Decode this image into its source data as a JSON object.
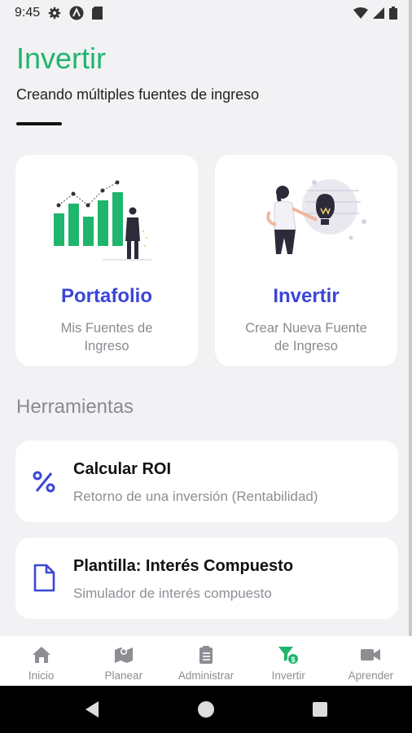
{
  "status": {
    "time": "9:45",
    "left_icons": [
      "gear-icon",
      "android-icon",
      "sd-card-icon"
    ],
    "right_icons": [
      "wifi-icon",
      "signal-icon",
      "battery-icon"
    ]
  },
  "header": {
    "title": "Invertir",
    "subtitle": "Creando múltiples fuentes de ingreso",
    "accent_color": "#1fb56d"
  },
  "cards": [
    {
      "title": "Portafolio",
      "description": "Mis Fuentes de Ingreso",
      "illustration": "bar-chart-person-illustration"
    },
    {
      "title": "Invertir",
      "description": "Crear Nueva Fuente de Ingreso",
      "illustration": "woman-lightbulb-illustration"
    }
  ],
  "tools": {
    "section_title": "Herramientas",
    "items": [
      {
        "title": "Calcular ROI",
        "description": "Retorno de una inversión (Rentabilidad)",
        "icon": "percent-icon"
      },
      {
        "title": "Plantilla: Interés Compuesto",
        "description": "Simulador de interés compuesto",
        "icon": "document-icon"
      }
    ]
  },
  "bottom_nav": {
    "active_index": 3,
    "active_color": "#1fb56d",
    "items": [
      {
        "label": "Inicio",
        "icon": "home-icon"
      },
      {
        "label": "Planear",
        "icon": "map-icon"
      },
      {
        "label": "Administrar",
        "icon": "clipboard-icon"
      },
      {
        "label": "Invertir",
        "icon": "filter-money-icon"
      },
      {
        "label": "Aprender",
        "icon": "video-camera-icon"
      }
    ]
  },
  "system_nav": [
    "back-icon",
    "home-circle-icon",
    "recents-icon"
  ]
}
